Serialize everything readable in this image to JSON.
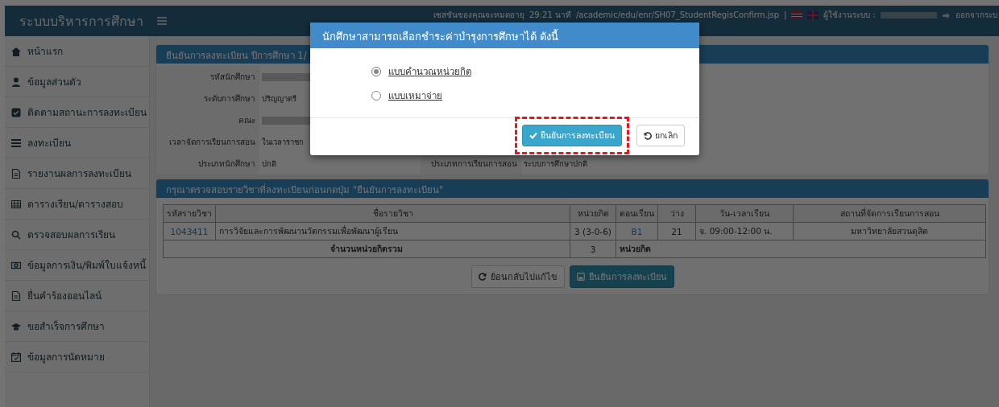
{
  "header": {
    "app_title": "ระบบบริหารการศึกษา",
    "session_text": "เซสชันของคุณจะหมดอายุ",
    "timer": "29:21 นาที",
    "path": "/academic/edu/enr/SH07_StudentRegisConfirm.jsp",
    "separator": "|",
    "user_label": "ผู้ใช้งานระบบ :",
    "logout": "ออกจากระบ"
  },
  "sidebar": {
    "items": [
      {
        "label": "หน้าแรก"
      },
      {
        "label": "ข้อมูลส่วนตัว"
      },
      {
        "label": "ติดตามสถานะการลงทะเบียน"
      },
      {
        "label": "ลงทะเบียน"
      },
      {
        "label": "รายงานผลการลงทะเบียน"
      },
      {
        "label": "ตารางเรียน/ตารางสอบ"
      },
      {
        "label": "ตรวจสอบผลการเรียน"
      },
      {
        "label": "ข้อมูลการเงิน/พิมพ์ใบแจ้งหนี้"
      },
      {
        "label": "ยื่นคำร้องออนไลน์"
      },
      {
        "label": "ขอสำเร็จการศึกษา"
      },
      {
        "label": "ข้อมูลการนัดหมาย"
      }
    ]
  },
  "info_panel": {
    "title": "ยืนยันการลงทะเบียน ปีการศึกษา 1/",
    "fields": [
      {
        "label": "รหัสนักศึกษา",
        "kind": "blurred"
      },
      {
        "label": "ระดับการศึกษา",
        "kind": "text",
        "value": "ปริญญาตรี"
      },
      {
        "label": "คณะ",
        "kind": "blurred"
      },
      {
        "label": "เวลาจัดการเรียนการสอน",
        "kind": "text",
        "value": "ในเวลาราชก"
      },
      {
        "label": "ประเภทนักศึกษา",
        "kind": "text",
        "value": "ปกติ",
        "right_label": "ประเภทการเรียนการสอน",
        "right_value": "ระบบการศึกษาปกติ"
      }
    ]
  },
  "course_panel": {
    "title": "กรุณาตรวจสอบรายวิชาที่ลงทะเบียนก่อนกดปุ่ม \"ยืนยันการลงทะเบียน\"",
    "table": {
      "columns": [
        "รหัสรายวิชา",
        "ชื่อรายวิชา",
        "หน่วยกิต",
        "ตอนเรียน",
        "ว่าง",
        "วัน-เวลาเรียน",
        "สถานที่จัดการเรียนการสอน"
      ],
      "rows": [
        [
          "1043411",
          "การวิจัยและการพัฒนานวัตกรรมเพื่อพัฒนาผู้เรียน",
          "3 (3-0-6)",
          "B1",
          "21",
          "จ. 09:00-12:00 น.",
          "มหาวิทยาลัยสวนดุสิต"
        ]
      ],
      "total": {
        "label": "จำนวนหน่วยกิตรวม",
        "value": "3",
        "unit": "หน่วยกิต"
      }
    },
    "buttons": [
      {
        "label": "ย้อนกลับไปแก้ไข",
        "kind": "back"
      },
      {
        "label": "ยืนยันการลงทะเบียน",
        "kind": "save"
      }
    ]
  },
  "modal": {
    "title": "นักศึกษาสามารถเลือกชำระค่าบำรุงการศึกษาได้ ดังนี้",
    "options": [
      {
        "label": "แบบคำนวณหน่วยกิต",
        "selected": true
      },
      {
        "label": "แบบเหมาจ่าย",
        "selected": false
      }
    ],
    "buttons": [
      {
        "label": "ยืนยันการลงทะเบียน",
        "kind": "confirm",
        "highlighted": true
      },
      {
        "label": "ยกเลิก",
        "kind": "cancel",
        "highlighted": false
      }
    ]
  }
}
